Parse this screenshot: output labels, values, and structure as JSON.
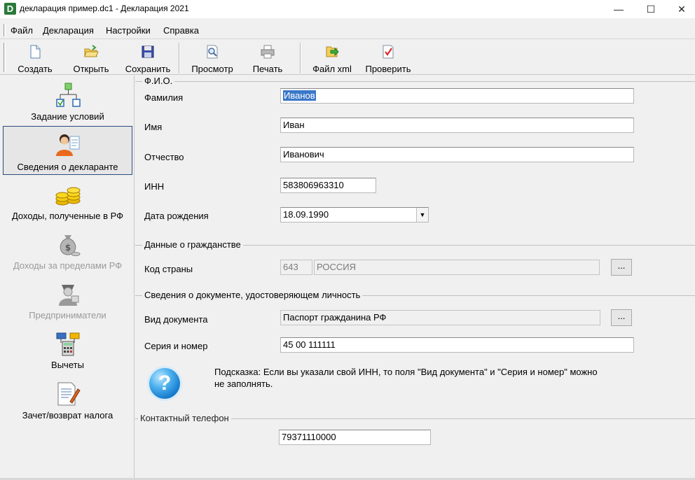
{
  "window": {
    "title": "декларация пример.dc1 - Декларация 2021",
    "app_icon_letter": "D",
    "controls": {
      "minimize": "—",
      "maximize": "☐",
      "close": "✕"
    }
  },
  "menu": [
    "Файл",
    "Декларация",
    "Настройки",
    "Справка"
  ],
  "toolbar": {
    "create": "Создать",
    "open": "Открыть",
    "save": "Сохранить",
    "preview": "Просмотр",
    "print": "Печать",
    "xml": "Файл xml",
    "check": "Проверить"
  },
  "nav": {
    "items": [
      {
        "label": "Задание условий",
        "icon": "flowchart-icon",
        "enabled": true,
        "selected": false
      },
      {
        "label": "Сведения о декларанте",
        "icon": "person-icon",
        "enabled": true,
        "selected": true
      },
      {
        "label": "Доходы, полученные в РФ",
        "icon": "coins-icon",
        "enabled": true,
        "selected": false
      },
      {
        "label": "Доходы за пределами РФ",
        "icon": "money-bag-icon",
        "enabled": false,
        "selected": false
      },
      {
        "label": "Предприниматели",
        "icon": "businessman-icon",
        "enabled": false,
        "selected": false
      },
      {
        "label": "Вычеты",
        "icon": "calculator-icon",
        "enabled": true,
        "selected": false
      },
      {
        "label": "Зачет/возврат налога",
        "icon": "document-pen-icon",
        "enabled": true,
        "selected": false
      }
    ]
  },
  "fio": {
    "title": "Ф.И.О.",
    "surname_label": "Фамилия",
    "surname_value": "Иванов",
    "name_label": "Имя",
    "name_value": "Иван",
    "patronymic_label": "Отчество",
    "patronymic_value": "Иванович",
    "inn_label": "ИНН",
    "inn_value": "583806963310",
    "dob_label": "Дата рождения",
    "dob_value": "18.09.1990"
  },
  "citizenship": {
    "title": "Данные о гражданстве",
    "country_label": "Код страны",
    "country_code": "643",
    "country_name": "РОССИЯ",
    "browse": "..."
  },
  "document": {
    "title": "Сведения о документе, удостоверяющем личность",
    "type_label": "Вид документа",
    "type_value": "Паспорт гражданина РФ",
    "browse": "...",
    "series_label": "Серия и номер",
    "series_value": "45 00 111111",
    "hint_line1": "Подсказка: Если вы указали свой ИНН, то поля \"Вид документа\" и \"Серия и номер\" можно",
    "hint_line2": "не заполнять.",
    "hint_icon_glyph": "?"
  },
  "contact": {
    "title": "Контактный телефон",
    "phone_value": "79371110000"
  },
  "colors": {
    "selection": "#3a78c8",
    "nav_selected_border": "#2b4c7e",
    "disabled_text": "#9a9a9a"
  }
}
